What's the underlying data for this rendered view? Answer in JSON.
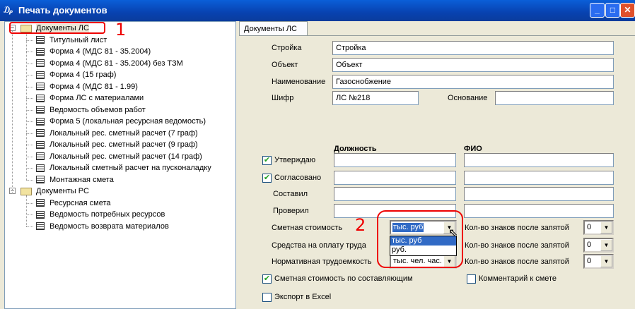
{
  "window": {
    "title": "Печать документов",
    "icon": "app-icon"
  },
  "tree": [
    {
      "label": "Документы ЛС",
      "type": "folder",
      "expanded": true,
      "children": [
        "Титульный лист",
        "Форма 4 (МДС 81 - 35.2004)",
        "Форма 4 (МДС 81 - 35.2004) без ТЗМ",
        "Форма 4 (15 граф)",
        "Форма 4 (МДС 81 - 1.99)",
        "Форма ЛС с материалами",
        "Ведомость объемов работ",
        "Форма 5 (локальная ресурсная ведомость)",
        "Локальный рес. сметный расчет (7 граф)",
        "Локальный рес. сметный расчет (9 граф)",
        "Локальный рес. сметный расчет (14 граф)",
        "Локальный сметный расчет на пусконаладку",
        "Монтажная смета"
      ]
    },
    {
      "label": "Документы РС",
      "type": "folder",
      "expanded": true,
      "children": [
        "Ресурсная смета",
        "Ведомость потребных ресурсов",
        "Ведомость возврата материалов"
      ]
    }
  ],
  "tab": "Документы ЛС",
  "form": {
    "stroika": {
      "label": "Стройка",
      "value": "Стройка"
    },
    "object": {
      "label": "Объект",
      "value": "Объект"
    },
    "name": {
      "label": "Наименование",
      "value": "Газоснобжение"
    },
    "cipher": {
      "label": "Шифр",
      "value": "ЛС №218"
    },
    "basis": {
      "label": "Основание",
      "value": ""
    },
    "col_position": "Должность",
    "col_fio": "ФИО",
    "signers": [
      {
        "label": "Утверждаю",
        "checked": true
      },
      {
        "label": "Согласовано",
        "checked": true
      },
      {
        "label": "Составил"
      },
      {
        "label": "Проверил"
      }
    ],
    "units": [
      {
        "label": "Сметная стоимость",
        "value": "тыс. руб",
        "decimals_label": "Кол-во знаков после запятой",
        "decimals": "0"
      },
      {
        "label": "Средства на оплату труда",
        "value": "",
        "decimals_label": "Кол-во знаков после запятой",
        "decimals": "0"
      },
      {
        "label": "Нормативная трудоемкость",
        "value": "тыс. чел. час.",
        "decimals_label": "Кол-во знаков после запятой",
        "decimals": "0"
      }
    ],
    "dropdown_options": [
      "тыс. руб",
      "руб."
    ],
    "by_components": {
      "label": "Сметная стоимость по составляющим",
      "checked": true
    },
    "comment": {
      "label": "Комментарий к смете",
      "checked": false
    },
    "excel": {
      "label": "Экспорт в Excel",
      "checked": false
    }
  },
  "annotations": [
    "1",
    "2"
  ],
  "check_glyph": "✔"
}
